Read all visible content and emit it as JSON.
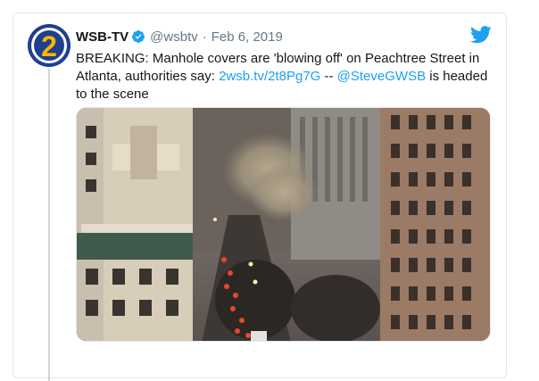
{
  "account": {
    "name": "WSB-TV",
    "handle": "@wsbtv",
    "separator": "·",
    "date": "Feb 6, 2019",
    "avatar_label": "2"
  },
  "tweet": {
    "text_part1": "BREAKING: Manhole covers are 'blowing off' on Peachtree Street in Atlanta, authorities say: ",
    "link": "2wsb.tv/2t8Pg7G",
    "text_part2": " -- ",
    "mention": "@SteveGWSB",
    "text_part3": " is headed to the scene"
  },
  "colors": {
    "link": "#1da1f2",
    "verified": "#1da1f2",
    "bird": "#1da1f2",
    "avatar_bg": "#1f3f8f",
    "avatar_digit": "#f5b800"
  },
  "icons": {
    "verified": "verified-badge-icon",
    "brand": "twitter-bird-icon"
  }
}
